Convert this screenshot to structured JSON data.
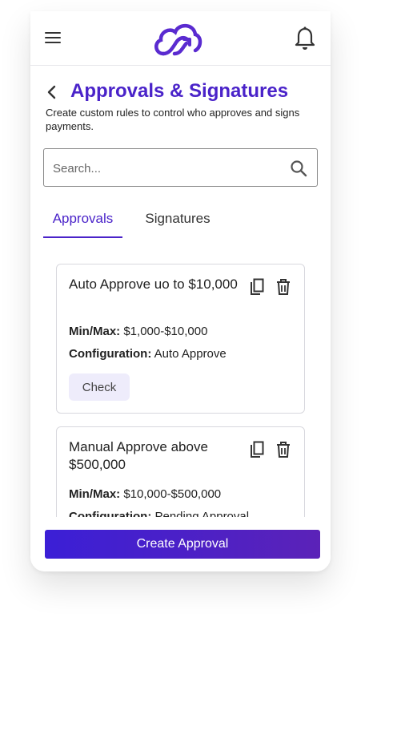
{
  "header": {
    "title": "Approvals & Signatures",
    "subtitle": "Create custom rules to control who approves and signs payments."
  },
  "search": {
    "placeholder": "Search..."
  },
  "tabs": [
    {
      "label": "Approvals",
      "active": true
    },
    {
      "label": "Signatures",
      "active": false
    }
  ],
  "approvals": [
    {
      "title": "Auto Approve uo to $10,000",
      "minmax_label": "Min/Max:",
      "minmax_value": "$1,000-$10,000",
      "config_label": "Configuration:",
      "config_value": "Auto Approve",
      "action_label": "Check"
    },
    {
      "title": "Manual Approve above $500,000",
      "minmax_label": "Min/Max:",
      "minmax_value": "$10,000-$500,000",
      "config_label": "Configuration:",
      "config_value": "Pending Approval"
    }
  ],
  "footer": {
    "create_label": "Create Approval"
  },
  "colors": {
    "brand": "#4a23c9",
    "button_gradient_start": "#3b1fd6",
    "button_gradient_end": "#5b22b8",
    "chip_bg": "#eeecfb"
  },
  "icons": [
    "menu-icon",
    "logo",
    "bell-icon",
    "back-icon",
    "search-icon",
    "copy-icon",
    "trash-icon"
  ]
}
